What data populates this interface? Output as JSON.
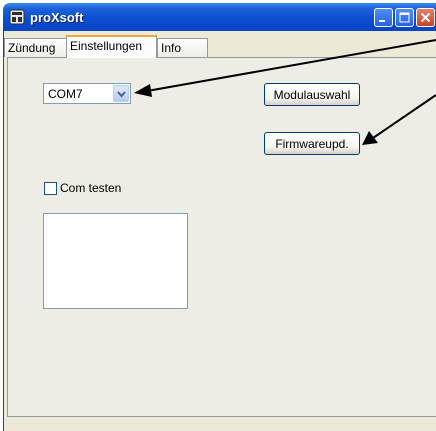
{
  "window": {
    "title": "proXsoft",
    "icon": "app-icon",
    "controls": [
      "minimize-icon",
      "maximize-icon",
      "close-icon"
    ]
  },
  "tabs": [
    {
      "label": "Zündung",
      "active": false
    },
    {
      "label": "Einstellungen",
      "active": true
    },
    {
      "label": "Info",
      "active": false
    }
  ],
  "settings": {
    "port_select": {
      "value": "COM7"
    },
    "modul_button": "Modulauswahl",
    "firmware_button": "Firmwareupd.",
    "com_test": {
      "label": "Com testen",
      "checked": false
    },
    "output": ""
  },
  "colors": {
    "titlebar": "#0a4fd0",
    "client_bg": "#ece9d8",
    "tab_highlight": "#f2a83a",
    "arrow": "#000000"
  }
}
